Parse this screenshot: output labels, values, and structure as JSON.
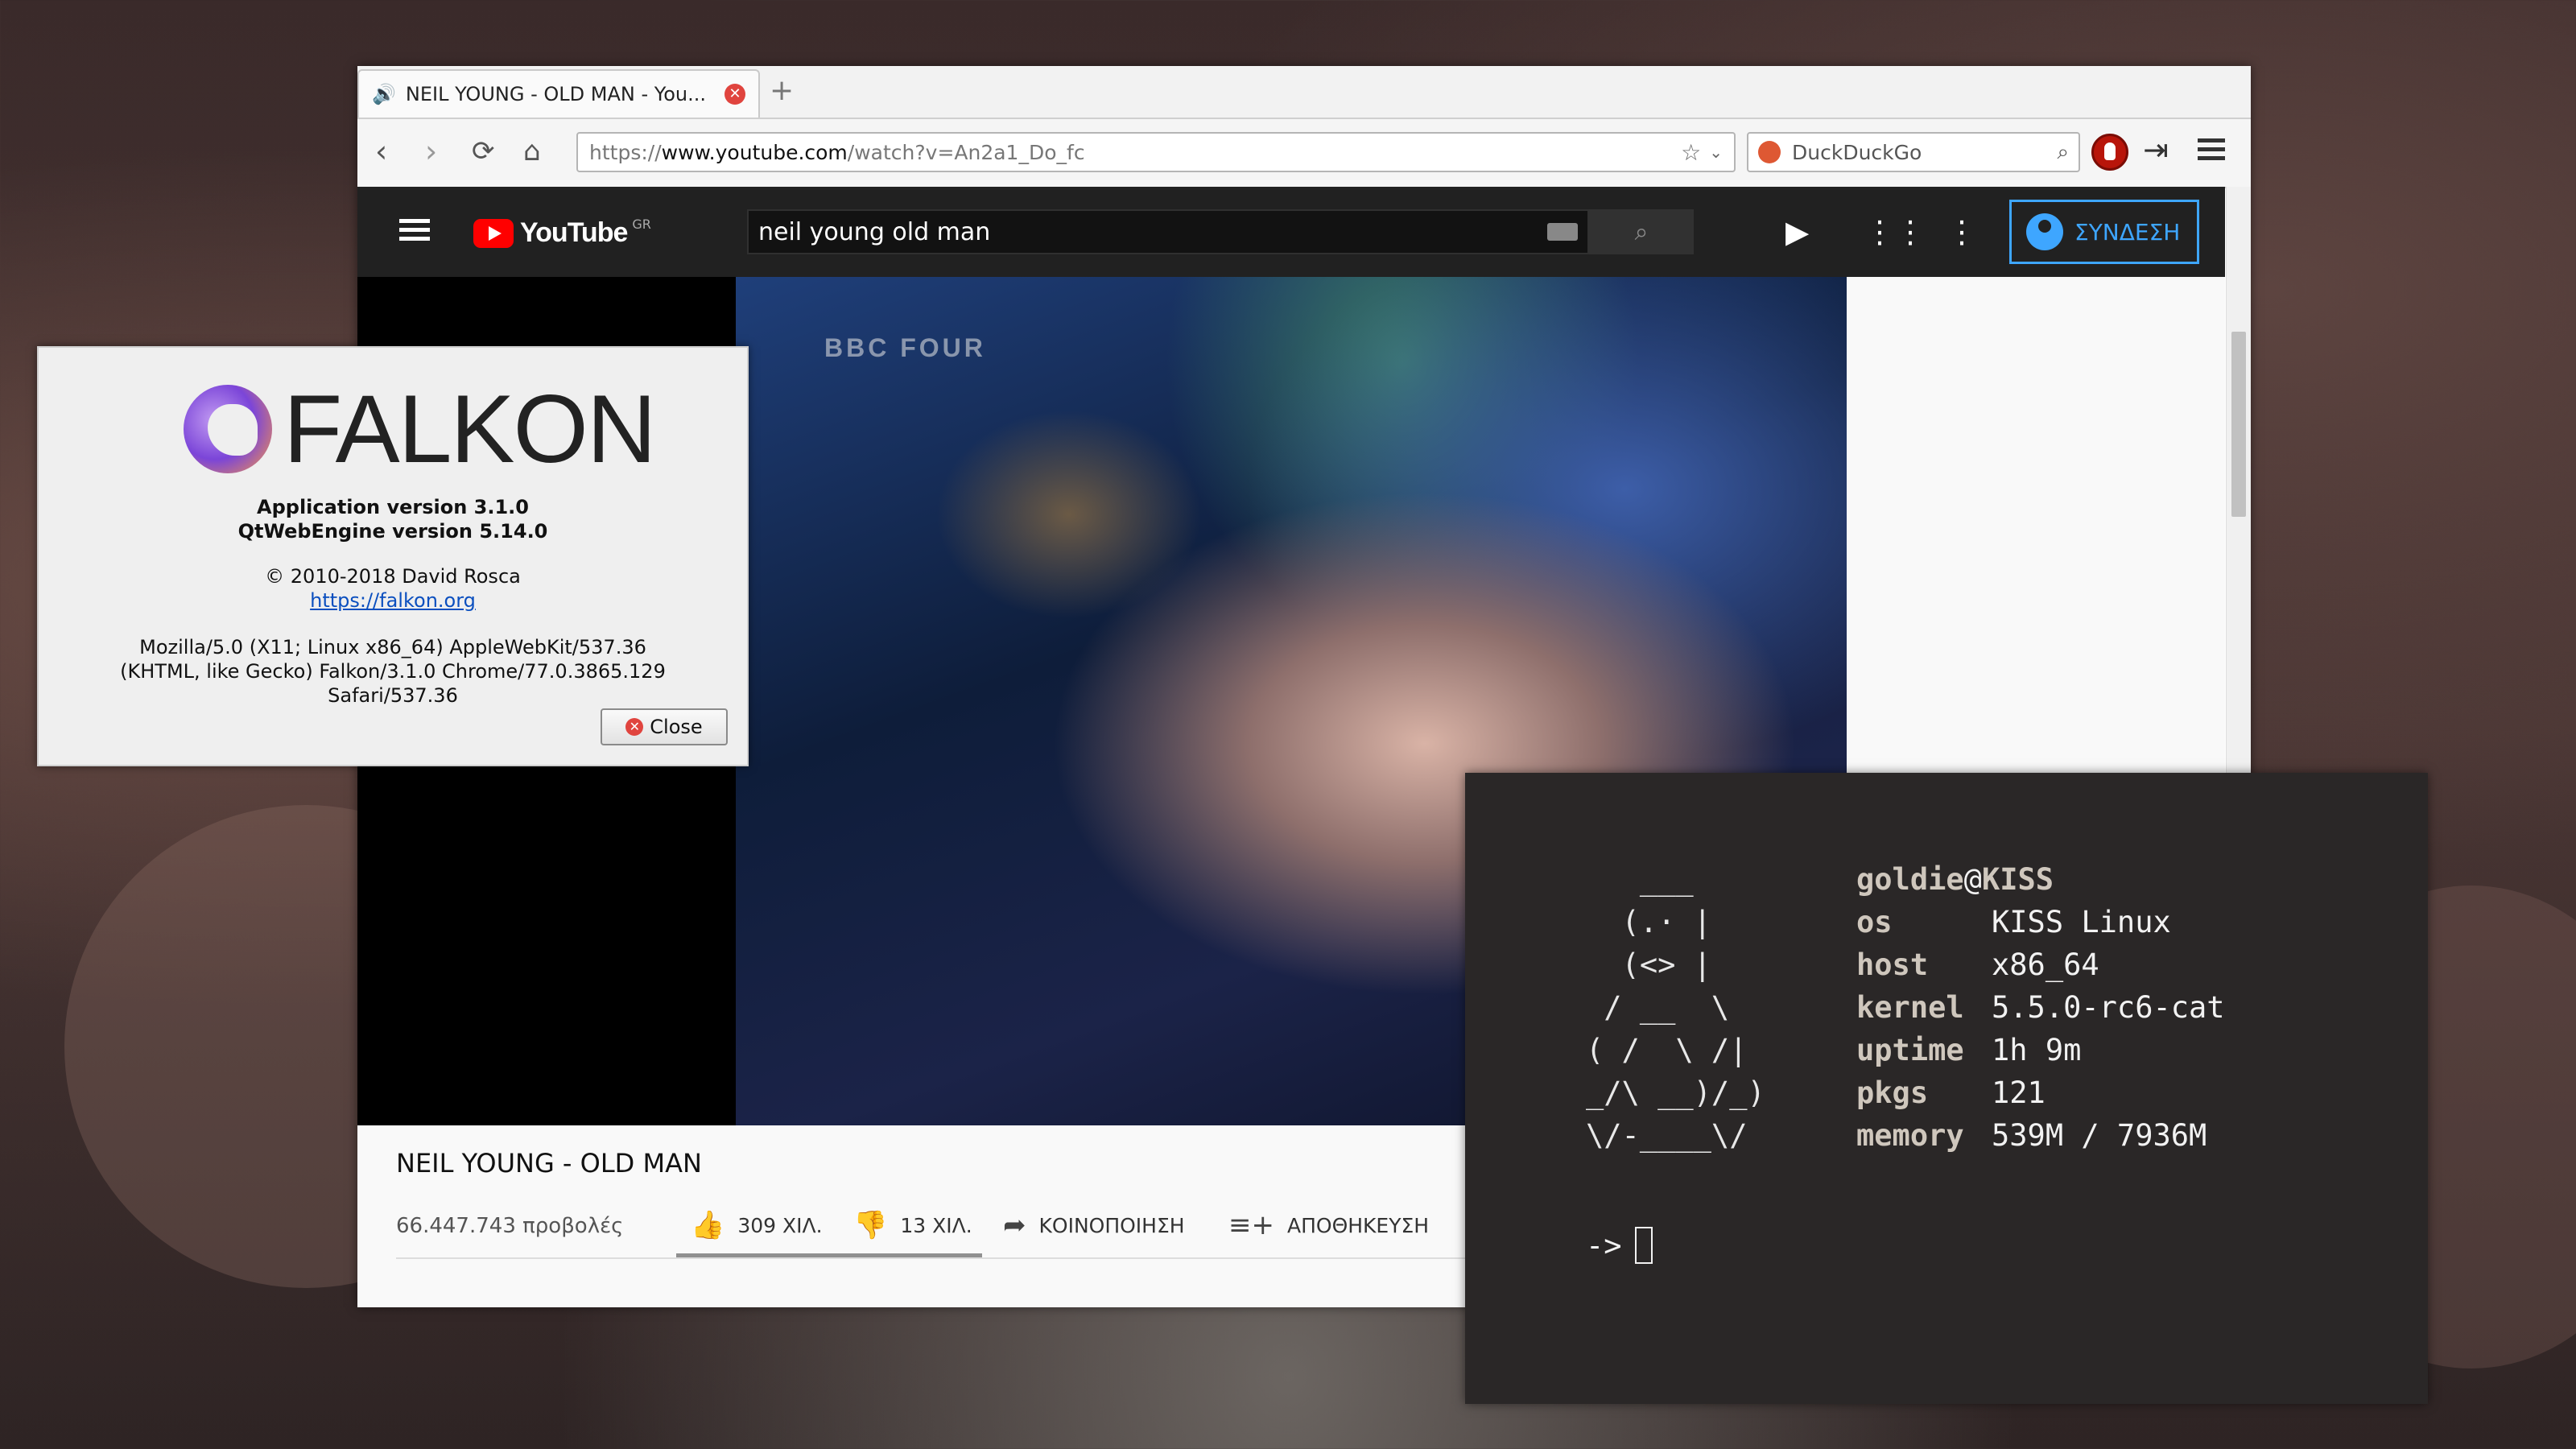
{
  "browser": {
    "tab_title": "NEIL YOUNG - OLD MAN - You...",
    "url_prefix": "https://",
    "url_domain": "www.youtube.com",
    "url_path": "/watch?v=An2a1_Do_fc",
    "search_placeholder": "DuckDuckGo",
    "new_tab_label": "+"
  },
  "youtube": {
    "logo_text": "YouTube",
    "country_code": "GR",
    "search_query": "neil young old man",
    "signin_label": "ΣΥΝΔΕΣΗ",
    "video_watermark": "BBC FOUR",
    "video_title": "NEIL YOUNG - OLD MAN",
    "views": "66.447.743 προβολές",
    "likes": "309 ΧΙΛ.",
    "dislikes": "13 ΧΙΛ.",
    "share_label": "ΚΟΙΝΟΠΟΙΗΣΗ",
    "save_label": "ΑΠΟΘΗΚΕΥΣΗ"
  },
  "about_dialog": {
    "brand": "FALKON",
    "app_version": "Application version 3.1.0",
    "engine_version": "QtWebEngine version 5.14.0",
    "copyright": "© 2010-2018 David Rosca",
    "website": "https://falkon.org",
    "ua_line1": "Mozilla/5.0 (X11; Linux x86_64) AppleWebKit/537.36",
    "ua_line2": "(KHTML, like Gecko) Falkon/3.1.0 Chrome/77.0.3865.129",
    "ua_line3": "Safari/537.36",
    "close_label": "Close"
  },
  "terminal": {
    "ascii_art": "   ___\n  (.· |\n  (<> |\n / __  \\\n( /  \\ /|\n_/\\ __)/_)\n\\/-____\\/",
    "user": "goldie",
    "at": "@",
    "host": "KISS",
    "rows": [
      {
        "key": "os",
        "value": "KISS Linux"
      },
      {
        "key": "host",
        "value": "x86_64"
      },
      {
        "key": "kernel",
        "value": "5.5.0-rc6-cat"
      },
      {
        "key": "uptime",
        "value": "1h 9m"
      },
      {
        "key": "pkgs",
        "value": "121"
      },
      {
        "key": "memory",
        "value": "539M / 7936M"
      }
    ],
    "prompt": "->"
  }
}
